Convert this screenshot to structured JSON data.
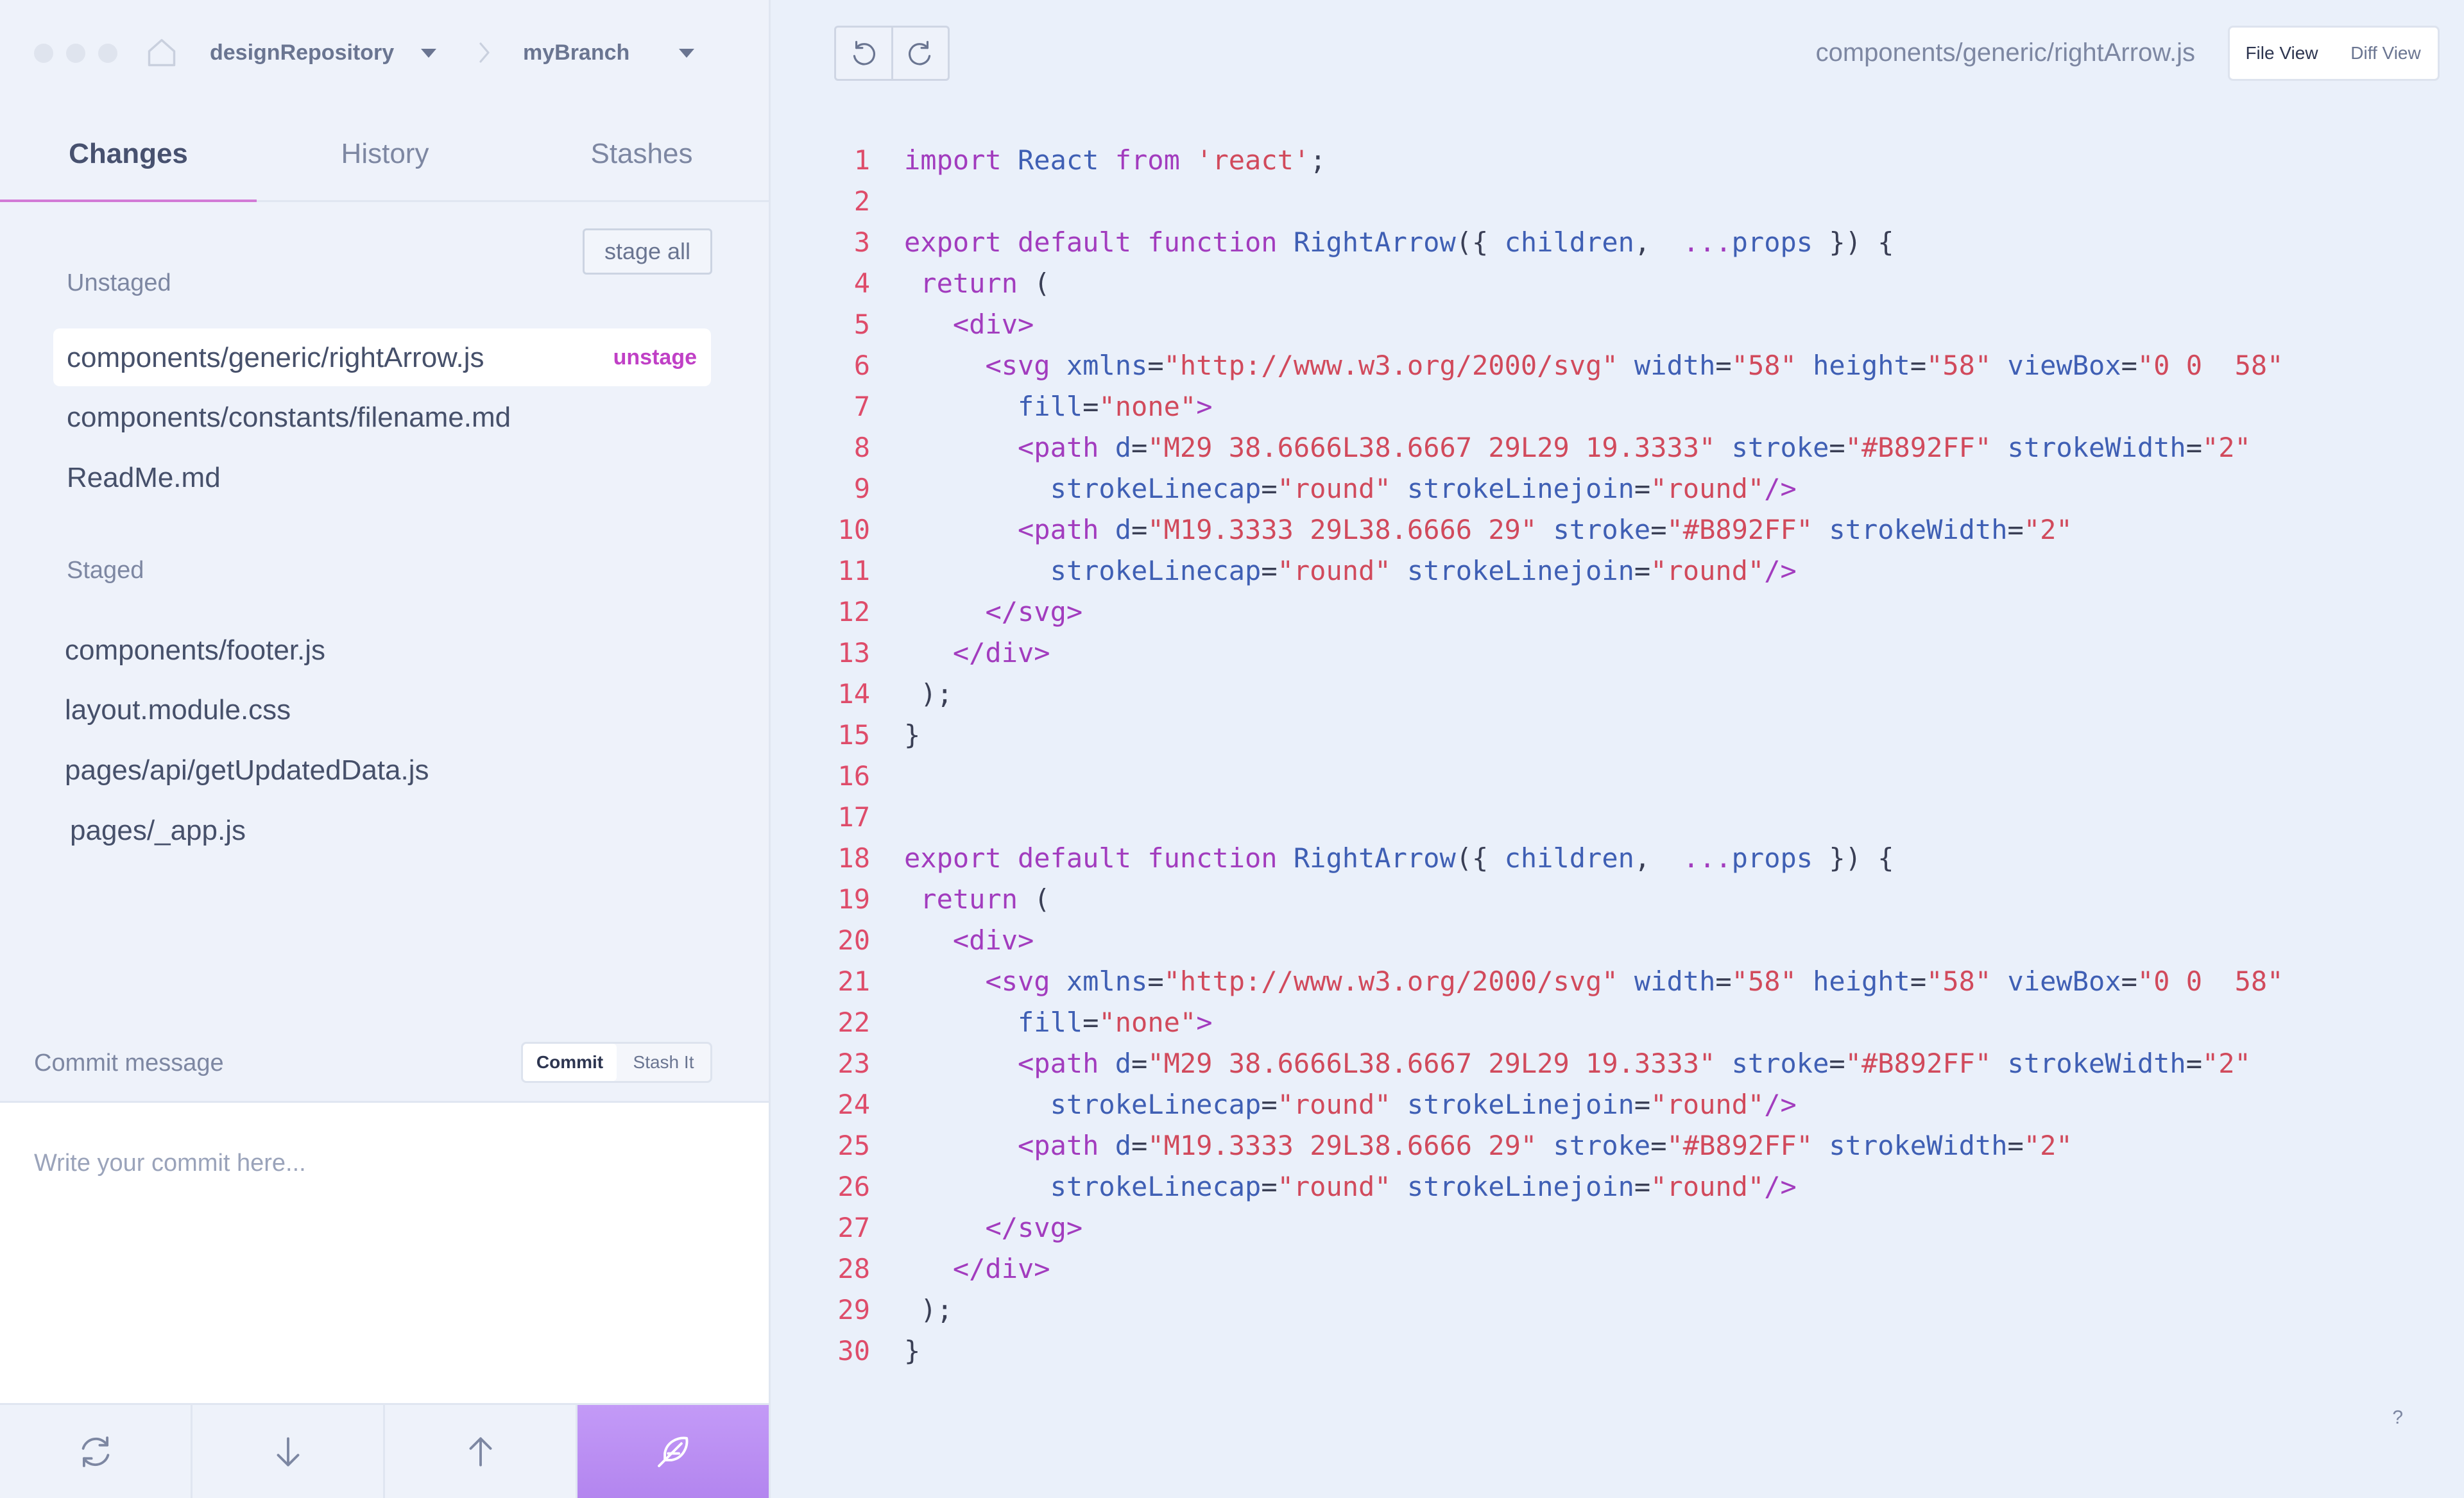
{
  "header": {
    "repository": "designRepository",
    "branch": "myBranch"
  },
  "tabs": [
    {
      "label": "Changes",
      "active": true
    },
    {
      "label": "History",
      "active": false
    },
    {
      "label": "Stashes",
      "active": false
    }
  ],
  "changes": {
    "stage_all_label": "stage all",
    "unstaged_label": "Unstaged",
    "unstaged_files": [
      "components/generic/rightArrow.js",
      "components/constants/filename.md",
      "ReadMe.md"
    ],
    "unstage_label": "unstage",
    "staged_label": "Staged",
    "staged_files": [
      "components/footer.js",
      "layout.module.css",
      "pages/api/getUpdatedData.js",
      "pages/_app.js"
    ]
  },
  "commit": {
    "label": "Commit message",
    "commit_button": "Commit",
    "stash_button": "Stash It",
    "placeholder": "Write your commit here..."
  },
  "bottom_actions": [
    {
      "name": "refresh-icon"
    },
    {
      "name": "pull-icon"
    },
    {
      "name": "push-icon"
    },
    {
      "name": "feather-icon"
    }
  ],
  "editor": {
    "file_path": "components/generic/rightArrow.js",
    "file_view_label": "File View",
    "diff_view_label": "Diff View",
    "help_label": "?"
  },
  "colors": {
    "accent": "#b385ef",
    "tab_underline": "#d27ad6",
    "unstage": "#c040c6",
    "line_number": "#de4c6a",
    "keyword": "#a23cbe",
    "identifier": "#3f5fb4",
    "string": "#d14a5c"
  },
  "code_lines": [
    [
      {
        "t": "import ",
        "c": "k"
      },
      {
        "t": "React ",
        "c": "i"
      },
      {
        "t": "from ",
        "c": "k"
      },
      {
        "t": "'react'",
        "c": "s"
      },
      {
        "t": ";",
        "c": "p"
      }
    ],
    [],
    [
      {
        "t": "export default function ",
        "c": "k"
      },
      {
        "t": "RightArrow",
        "c": "i"
      },
      {
        "t": "({ ",
        "c": "p"
      },
      {
        "t": "children",
        "c": "i"
      },
      {
        "t": ",  ",
        "c": "p"
      },
      {
        "t": "...",
        "c": "k"
      },
      {
        "t": "props",
        "c": "i"
      },
      {
        "t": " }) {",
        "c": "p"
      }
    ],
    [
      {
        "t": " return ",
        "c": "k"
      },
      {
        "t": "(",
        "c": "p"
      }
    ],
    [
      {
        "t": "   ",
        "c": "p"
      },
      {
        "t": "<div>",
        "c": "tag"
      }
    ],
    [
      {
        "t": "     ",
        "c": "p"
      },
      {
        "t": "<svg ",
        "c": "tag"
      },
      {
        "t": "xmlns",
        "c": "at"
      },
      {
        "t": "=",
        "c": "p"
      },
      {
        "t": "\"http://www.w3.org/2000/svg\" ",
        "c": "s"
      },
      {
        "t": "width",
        "c": "at"
      },
      {
        "t": "=",
        "c": "p"
      },
      {
        "t": "\"58\" ",
        "c": "s"
      },
      {
        "t": "height",
        "c": "at"
      },
      {
        "t": "=",
        "c": "p"
      },
      {
        "t": "\"58\" ",
        "c": "s"
      },
      {
        "t": "viewBox",
        "c": "at"
      },
      {
        "t": "=",
        "c": "p"
      },
      {
        "t": "\"0 0  58\"",
        "c": "s"
      }
    ],
    [
      {
        "t": "       ",
        "c": "p"
      },
      {
        "t": "fill",
        "c": "at"
      },
      {
        "t": "=",
        "c": "p"
      },
      {
        "t": "\"none\"",
        "c": "s"
      },
      {
        "t": ">",
        "c": "tag"
      }
    ],
    [
      {
        "t": "       ",
        "c": "p"
      },
      {
        "t": "<path ",
        "c": "tag"
      },
      {
        "t": "d",
        "c": "at"
      },
      {
        "t": "=",
        "c": "p"
      },
      {
        "t": "\"M29 38.6666L38.6667 29L29 19.3333\" ",
        "c": "s"
      },
      {
        "t": "stroke",
        "c": "at"
      },
      {
        "t": "=",
        "c": "p"
      },
      {
        "t": "\"#B892FF\" ",
        "c": "s"
      },
      {
        "t": "strokeWidth",
        "c": "at"
      },
      {
        "t": "=",
        "c": "p"
      },
      {
        "t": "\"2\"",
        "c": "s"
      }
    ],
    [
      {
        "t": "         ",
        "c": "p"
      },
      {
        "t": "strokeLinecap",
        "c": "at"
      },
      {
        "t": "=",
        "c": "p"
      },
      {
        "t": "\"round\" ",
        "c": "s"
      },
      {
        "t": "strokeLinejoin",
        "c": "at"
      },
      {
        "t": "=",
        "c": "p"
      },
      {
        "t": "\"round\"",
        "c": "s"
      },
      {
        "t": "/>",
        "c": "tag"
      }
    ],
    [
      {
        "t": "       ",
        "c": "p"
      },
      {
        "t": "<path ",
        "c": "tag"
      },
      {
        "t": "d",
        "c": "at"
      },
      {
        "t": "=",
        "c": "p"
      },
      {
        "t": "\"M19.3333 29L38.6666 29\" ",
        "c": "s"
      },
      {
        "t": "stroke",
        "c": "at"
      },
      {
        "t": "=",
        "c": "p"
      },
      {
        "t": "\"#B892FF\" ",
        "c": "s"
      },
      {
        "t": "strokeWidth",
        "c": "at"
      },
      {
        "t": "=",
        "c": "p"
      },
      {
        "t": "\"2\"",
        "c": "s"
      }
    ],
    [
      {
        "t": "         ",
        "c": "p"
      },
      {
        "t": "strokeLinecap",
        "c": "at"
      },
      {
        "t": "=",
        "c": "p"
      },
      {
        "t": "\"round\" ",
        "c": "s"
      },
      {
        "t": "strokeLinejoin",
        "c": "at"
      },
      {
        "t": "=",
        "c": "p"
      },
      {
        "t": "\"round\"",
        "c": "s"
      },
      {
        "t": "/>",
        "c": "tag"
      }
    ],
    [
      {
        "t": "     ",
        "c": "p"
      },
      {
        "t": "</svg>",
        "c": "tag"
      }
    ],
    [
      {
        "t": "   ",
        "c": "p"
      },
      {
        "t": "</div>",
        "c": "tag"
      }
    ],
    [
      {
        "t": " );",
        "c": "p"
      }
    ],
    [
      {
        "t": "}",
        "c": "p"
      }
    ],
    [],
    [],
    [
      {
        "t": "export default function ",
        "c": "k"
      },
      {
        "t": "RightArrow",
        "c": "i"
      },
      {
        "t": "({ ",
        "c": "p"
      },
      {
        "t": "children",
        "c": "i"
      },
      {
        "t": ",  ",
        "c": "p"
      },
      {
        "t": "...",
        "c": "k"
      },
      {
        "t": "props",
        "c": "i"
      },
      {
        "t": " }) {",
        "c": "p"
      }
    ],
    [
      {
        "t": " return ",
        "c": "k"
      },
      {
        "t": "(",
        "c": "p"
      }
    ],
    [
      {
        "t": "   ",
        "c": "p"
      },
      {
        "t": "<div>",
        "c": "tag"
      }
    ],
    [
      {
        "t": "     ",
        "c": "p"
      },
      {
        "t": "<svg ",
        "c": "tag"
      },
      {
        "t": "xmlns",
        "c": "at"
      },
      {
        "t": "=",
        "c": "p"
      },
      {
        "t": "\"http://www.w3.org/2000/svg\" ",
        "c": "s"
      },
      {
        "t": "width",
        "c": "at"
      },
      {
        "t": "=",
        "c": "p"
      },
      {
        "t": "\"58\" ",
        "c": "s"
      },
      {
        "t": "height",
        "c": "at"
      },
      {
        "t": "=",
        "c": "p"
      },
      {
        "t": "\"58\" ",
        "c": "s"
      },
      {
        "t": "viewBox",
        "c": "at"
      },
      {
        "t": "=",
        "c": "p"
      },
      {
        "t": "\"0 0  58\"",
        "c": "s"
      }
    ],
    [
      {
        "t": "       ",
        "c": "p"
      },
      {
        "t": "fill",
        "c": "at"
      },
      {
        "t": "=",
        "c": "p"
      },
      {
        "t": "\"none\"",
        "c": "s"
      },
      {
        "t": ">",
        "c": "tag"
      }
    ],
    [
      {
        "t": "       ",
        "c": "p"
      },
      {
        "t": "<path ",
        "c": "tag"
      },
      {
        "t": "d",
        "c": "at"
      },
      {
        "t": "=",
        "c": "p"
      },
      {
        "t": "\"M29 38.6666L38.6667 29L29 19.3333\" ",
        "c": "s"
      },
      {
        "t": "stroke",
        "c": "at"
      },
      {
        "t": "=",
        "c": "p"
      },
      {
        "t": "\"#B892FF\" ",
        "c": "s"
      },
      {
        "t": "strokeWidth",
        "c": "at"
      },
      {
        "t": "=",
        "c": "p"
      },
      {
        "t": "\"2\"",
        "c": "s"
      }
    ],
    [
      {
        "t": "         ",
        "c": "p"
      },
      {
        "t": "strokeLinecap",
        "c": "at"
      },
      {
        "t": "=",
        "c": "p"
      },
      {
        "t": "\"round\" ",
        "c": "s"
      },
      {
        "t": "strokeLinejoin",
        "c": "at"
      },
      {
        "t": "=",
        "c": "p"
      },
      {
        "t": "\"round\"",
        "c": "s"
      },
      {
        "t": "/>",
        "c": "tag"
      }
    ],
    [
      {
        "t": "       ",
        "c": "p"
      },
      {
        "t": "<path ",
        "c": "tag"
      },
      {
        "t": "d",
        "c": "at"
      },
      {
        "t": "=",
        "c": "p"
      },
      {
        "t": "\"M19.3333 29L38.6666 29\" ",
        "c": "s"
      },
      {
        "t": "stroke",
        "c": "at"
      },
      {
        "t": "=",
        "c": "p"
      },
      {
        "t": "\"#B892FF\" ",
        "c": "s"
      },
      {
        "t": "strokeWidth",
        "c": "at"
      },
      {
        "t": "=",
        "c": "p"
      },
      {
        "t": "\"2\"",
        "c": "s"
      }
    ],
    [
      {
        "t": "         ",
        "c": "p"
      },
      {
        "t": "strokeLinecap",
        "c": "at"
      },
      {
        "t": "=",
        "c": "p"
      },
      {
        "t": "\"round\" ",
        "c": "s"
      },
      {
        "t": "strokeLinejoin",
        "c": "at"
      },
      {
        "t": "=",
        "c": "p"
      },
      {
        "t": "\"round\"",
        "c": "s"
      },
      {
        "t": "/>",
        "c": "tag"
      }
    ],
    [
      {
        "t": "     ",
        "c": "p"
      },
      {
        "t": "</svg>",
        "c": "tag"
      }
    ],
    [
      {
        "t": "   ",
        "c": "p"
      },
      {
        "t": "</div>",
        "c": "tag"
      }
    ],
    [
      {
        "t": " );",
        "c": "p"
      }
    ],
    [
      {
        "t": "}",
        "c": "p"
      }
    ]
  ]
}
